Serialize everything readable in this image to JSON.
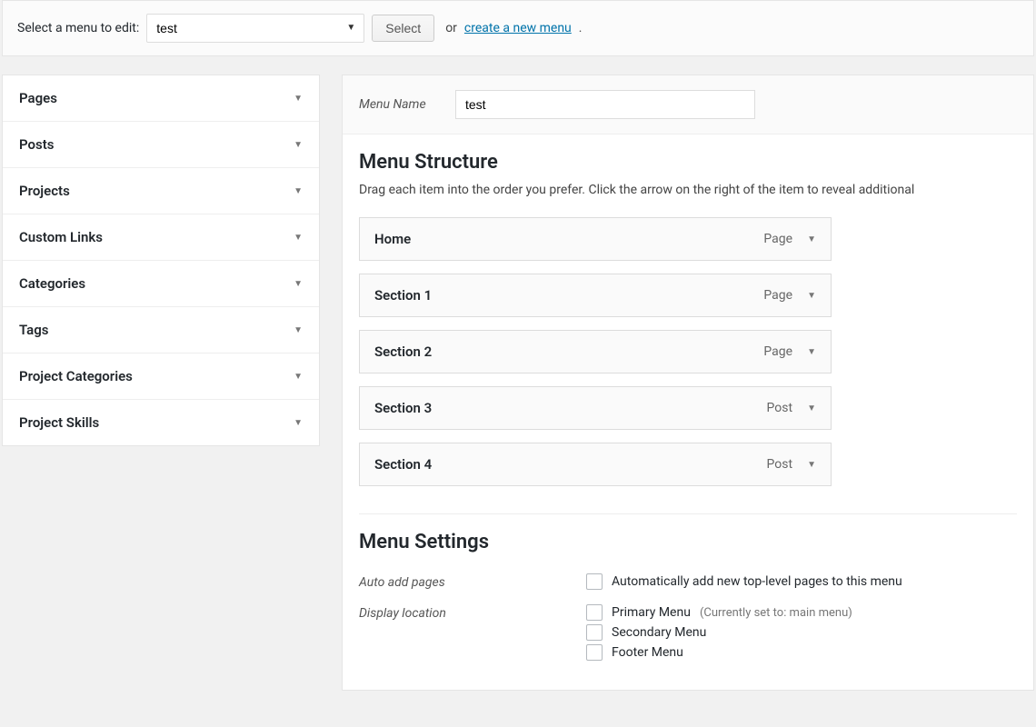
{
  "topbar": {
    "label": "Select a menu to edit:",
    "selected_menu": "test",
    "select_button": "Select",
    "or": "or",
    "create_link": "create a new menu",
    "period": "."
  },
  "sidebar": {
    "items": [
      {
        "label": "Pages"
      },
      {
        "label": "Posts"
      },
      {
        "label": "Projects"
      },
      {
        "label": "Custom Links"
      },
      {
        "label": "Categories"
      },
      {
        "label": "Tags"
      },
      {
        "label": "Project Categories"
      },
      {
        "label": "Project Skills"
      }
    ]
  },
  "menu_name": {
    "label": "Menu Name",
    "value": "test"
  },
  "structure": {
    "heading": "Menu Structure",
    "description": "Drag each item into the order you prefer. Click the arrow on the right of the item to reveal additional",
    "items": [
      {
        "label": "Home",
        "type": "Page"
      },
      {
        "label": "Section 1",
        "type": "Page"
      },
      {
        "label": "Section 2",
        "type": "Page"
      },
      {
        "label": "Section 3",
        "type": "Post"
      },
      {
        "label": "Section 4",
        "type": "Post"
      }
    ]
  },
  "settings": {
    "heading": "Menu Settings",
    "auto_add": {
      "label": "Auto add pages",
      "option": "Automatically add new top-level pages to this menu"
    },
    "display_location": {
      "label": "Display location",
      "options": [
        {
          "text": "Primary Menu",
          "note": "(Currently set to: main menu)"
        },
        {
          "text": "Secondary Menu",
          "note": ""
        },
        {
          "text": "Footer Menu",
          "note": ""
        }
      ]
    }
  }
}
